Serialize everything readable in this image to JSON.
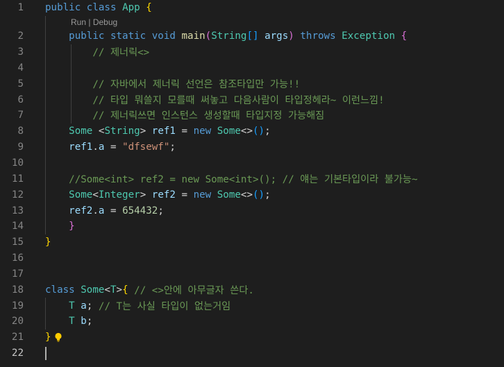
{
  "editor": {
    "codelens": {
      "run": "Run",
      "sep": " | ",
      "debug": "Debug",
      "after_line": 1
    },
    "current_line": 22,
    "lines": [
      {
        "n": "1",
        "indent": 0,
        "tokens": [
          [
            "public",
            "kw"
          ],
          [
            " ",
            "pl"
          ],
          [
            "class",
            "kw"
          ],
          [
            " ",
            "pl"
          ],
          [
            "App",
            "ty"
          ],
          [
            " ",
            "pl"
          ],
          [
            "{",
            "p1"
          ]
        ]
      },
      {
        "n": "2",
        "indent": 1,
        "tokens": [
          [
            "public",
            "kw"
          ],
          [
            " ",
            "pl"
          ],
          [
            "static",
            "kw"
          ],
          [
            " ",
            "pl"
          ],
          [
            "void",
            "kw"
          ],
          [
            " ",
            "pl"
          ],
          [
            "main",
            "fn"
          ],
          [
            "(",
            "p2"
          ],
          [
            "String",
            "ty"
          ],
          [
            "[]",
            "p3"
          ],
          [
            " ",
            "pl"
          ],
          [
            "args",
            "var"
          ],
          [
            ")",
            "p2"
          ],
          [
            " ",
            "pl"
          ],
          [
            "throws",
            "kw"
          ],
          [
            " ",
            "pl"
          ],
          [
            "Exception",
            "ty"
          ],
          [
            " ",
            "pl"
          ],
          [
            "{",
            "p2"
          ]
        ]
      },
      {
        "n": "3",
        "indent": 2,
        "tokens": [
          [
            "// 제너릭<>",
            "com"
          ]
        ]
      },
      {
        "n": "4",
        "indent": 2,
        "tokens": []
      },
      {
        "n": "5",
        "indent": 2,
        "tokens": [
          [
            "// 자바에서 제너릭 선언은 참조타입만 가능!!",
            "com"
          ]
        ]
      },
      {
        "n": "6",
        "indent": 2,
        "tokens": [
          [
            "// 타입 뭐쓸지 모를때 써놓고 다음사람이 타입정헤라~ 이런느낌!",
            "com"
          ]
        ]
      },
      {
        "n": "7",
        "indent": 2,
        "tokens": [
          [
            "// 제너릭쓰면 인스턴스 생성할때 타입지정 가능해짐",
            "com"
          ]
        ]
      },
      {
        "n": "8",
        "indent": 1,
        "tokens": [
          [
            "Some",
            "ty"
          ],
          [
            " <",
            "pl"
          ],
          [
            "String",
            "ty"
          ],
          [
            "> ",
            "pl"
          ],
          [
            "ref1",
            "var"
          ],
          [
            " = ",
            "pl"
          ],
          [
            "new",
            "kw"
          ],
          [
            " ",
            "pl"
          ],
          [
            "Some",
            "ty"
          ],
          [
            "<>",
            "pl"
          ],
          [
            "()",
            "p3"
          ],
          [
            ";",
            "pl"
          ]
        ]
      },
      {
        "n": "9",
        "indent": 1,
        "tokens": [
          [
            "ref1",
            "var"
          ],
          [
            ".",
            "pl"
          ],
          [
            "a",
            "var"
          ],
          [
            " = ",
            "pl"
          ],
          [
            "\"dfsewf\"",
            "str"
          ],
          [
            ";",
            "pl"
          ]
        ]
      },
      {
        "n": "10",
        "indent": 1,
        "tokens": []
      },
      {
        "n": "11",
        "indent": 1,
        "tokens": [
          [
            "//Some<int> ref2 = new Some<int>(); // 얘는 기본타입이라 불가능~",
            "com"
          ]
        ]
      },
      {
        "n": "12",
        "indent": 1,
        "tokens": [
          [
            "Some",
            "ty"
          ],
          [
            "<",
            "pl"
          ],
          [
            "Integer",
            "ty"
          ],
          [
            "> ",
            "pl"
          ],
          [
            "ref2",
            "var"
          ],
          [
            " = ",
            "pl"
          ],
          [
            "new",
            "kw"
          ],
          [
            " ",
            "pl"
          ],
          [
            "Some",
            "ty"
          ],
          [
            "<>",
            "pl"
          ],
          [
            "()",
            "p3"
          ],
          [
            ";",
            "pl"
          ]
        ]
      },
      {
        "n": "13",
        "indent": 1,
        "tokens": [
          [
            "ref2",
            "var"
          ],
          [
            ".",
            "pl"
          ],
          [
            "a",
            "var"
          ],
          [
            " = ",
            "pl"
          ],
          [
            "654432",
            "num"
          ],
          [
            ";",
            "pl"
          ]
        ]
      },
      {
        "n": "14",
        "indent": 1,
        "tokens": [
          [
            "}",
            "p2"
          ]
        ]
      },
      {
        "n": "15",
        "indent": 0,
        "tokens": [
          [
            "}",
            "p1"
          ]
        ]
      },
      {
        "n": "16",
        "indent": 0,
        "tokens": []
      },
      {
        "n": "17",
        "indent": 0,
        "tokens": []
      },
      {
        "n": "18",
        "indent": 0,
        "tokens": [
          [
            "class",
            "kw"
          ],
          [
            " ",
            "pl"
          ],
          [
            "Some",
            "ty"
          ],
          [
            "<",
            "pl"
          ],
          [
            "T",
            "ty"
          ],
          [
            ">",
            "pl"
          ],
          [
            "{",
            "p1"
          ],
          [
            " ",
            "pl"
          ],
          [
            "// <>안에 아무글자 쓴다.",
            "com"
          ]
        ]
      },
      {
        "n": "19",
        "indent": 1,
        "tokens": [
          [
            "T",
            "ty"
          ],
          [
            " ",
            "pl"
          ],
          [
            "a",
            "var"
          ],
          [
            "; ",
            "pl"
          ],
          [
            "// T는 사실 타입이 없는거임",
            "com"
          ]
        ]
      },
      {
        "n": "20",
        "indent": 1,
        "tokens": [
          [
            "T",
            "ty"
          ],
          [
            " ",
            "pl"
          ],
          [
            "b",
            "var"
          ],
          [
            ";",
            "pl"
          ]
        ]
      },
      {
        "n": "21",
        "indent": 0,
        "tokens": [
          [
            "}",
            "p1"
          ]
        ],
        "lightbulb": true
      },
      {
        "n": "22",
        "indent": 0,
        "tokens": []
      }
    ]
  }
}
